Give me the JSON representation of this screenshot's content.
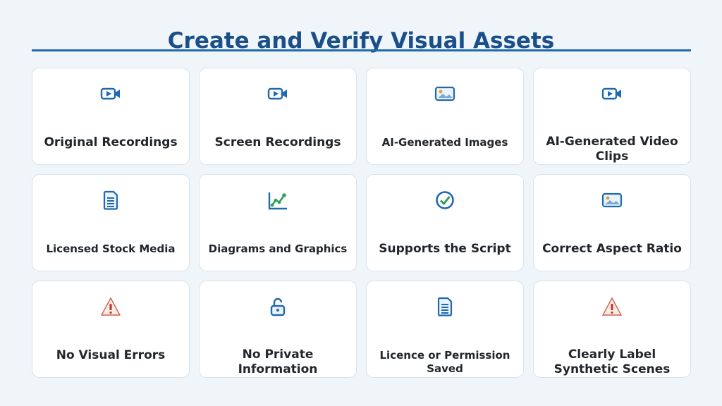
{
  "title": "Create and Verify Visual Assets",
  "colors": {
    "title": "#1b4f8a",
    "rule": "#2169ad",
    "icon_blue": "#2169ad",
    "icon_green": "#2e9e5b",
    "icon_warning": "#d0604a",
    "card_border": "#d8e2ec",
    "background": "#f0f5fa"
  },
  "cards": [
    {
      "label": "Original Recordings",
      "icon": "video-camera-icon"
    },
    {
      "label": "Screen Recordings",
      "icon": "video-camera-icon"
    },
    {
      "label": "AI-Generated Images",
      "icon": "image-icon"
    },
    {
      "label": "AI-Generated Video Clips",
      "icon": "video-camera-icon"
    },
    {
      "label": "Licensed Stock Media",
      "icon": "document-icon"
    },
    {
      "label": "Diagrams and Graphics",
      "icon": "line-chart-icon"
    },
    {
      "label": "Supports the Script",
      "icon": "check-circle-icon"
    },
    {
      "label": "Correct Aspect Ratio",
      "icon": "image-icon"
    },
    {
      "label": "No Visual Errors",
      "icon": "warning-icon"
    },
    {
      "label": "No Private Information",
      "icon": "unlock-icon"
    },
    {
      "label": "Licence or Permission Saved",
      "icon": "document-icon"
    },
    {
      "label": "Clearly Label Synthetic Scenes",
      "icon": "warning-icon"
    }
  ]
}
